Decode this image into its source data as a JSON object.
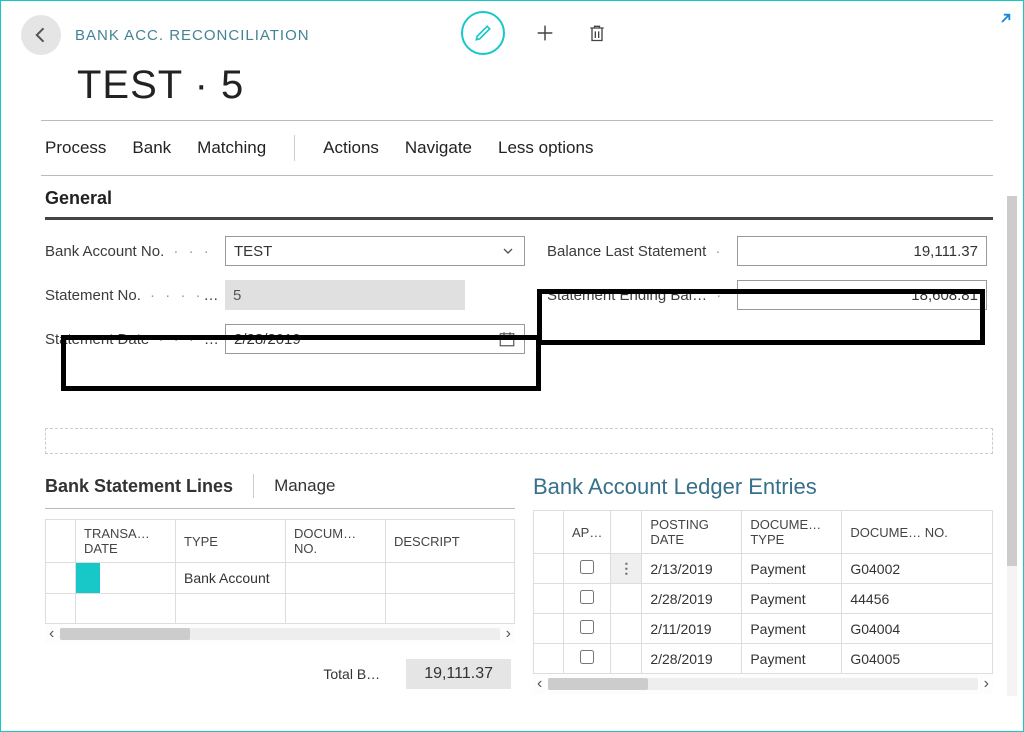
{
  "header": {
    "breadcrumb": "BANK ACC. RECONCILIATION",
    "title": "TEST · 5"
  },
  "tabs": {
    "process": "Process",
    "bank": "Bank",
    "matching": "Matching",
    "actions": "Actions",
    "navigate": "Navigate",
    "less": "Less options"
  },
  "general": {
    "heading": "General",
    "bank_account_label": "Bank Account No.",
    "bank_account_value": "TEST",
    "statement_no_label": "Statement No.",
    "statement_no_value": "5",
    "statement_date_label": "Statement Date",
    "statement_date_value": "2/28/2019",
    "balance_last_label": "Balance Last Statement",
    "balance_last_value": "19,111.37",
    "statement_ending_label": "Statement Ending Bal…",
    "statement_ending_value": "18,608.81"
  },
  "statement_lines": {
    "heading": "Bank Statement Lines",
    "manage": "Manage",
    "columns": {
      "transaction_date": "TRANSA… DATE",
      "type": "TYPE",
      "document_no": "DOCUM… NO.",
      "description": "DESCRIPT"
    },
    "row1_type": "Bank Account",
    "total_label": "Total B…",
    "total_value": "19,111.37"
  },
  "ledger": {
    "heading": "Bank Account Ledger Entries",
    "columns": {
      "applied": "AP…",
      "posting_date": "POSTING DATE",
      "document_type": "DOCUME… TYPE",
      "document_no": "DOCUME… NO."
    },
    "rows": [
      {
        "date": "2/13/2019",
        "type": "Payment",
        "no": "G04002"
      },
      {
        "date": "2/28/2019",
        "type": "Payment",
        "no": "44456"
      },
      {
        "date": "2/11/2019",
        "type": "Payment",
        "no": "G04004"
      },
      {
        "date": "2/28/2019",
        "type": "Payment",
        "no": "G04005"
      }
    ]
  }
}
